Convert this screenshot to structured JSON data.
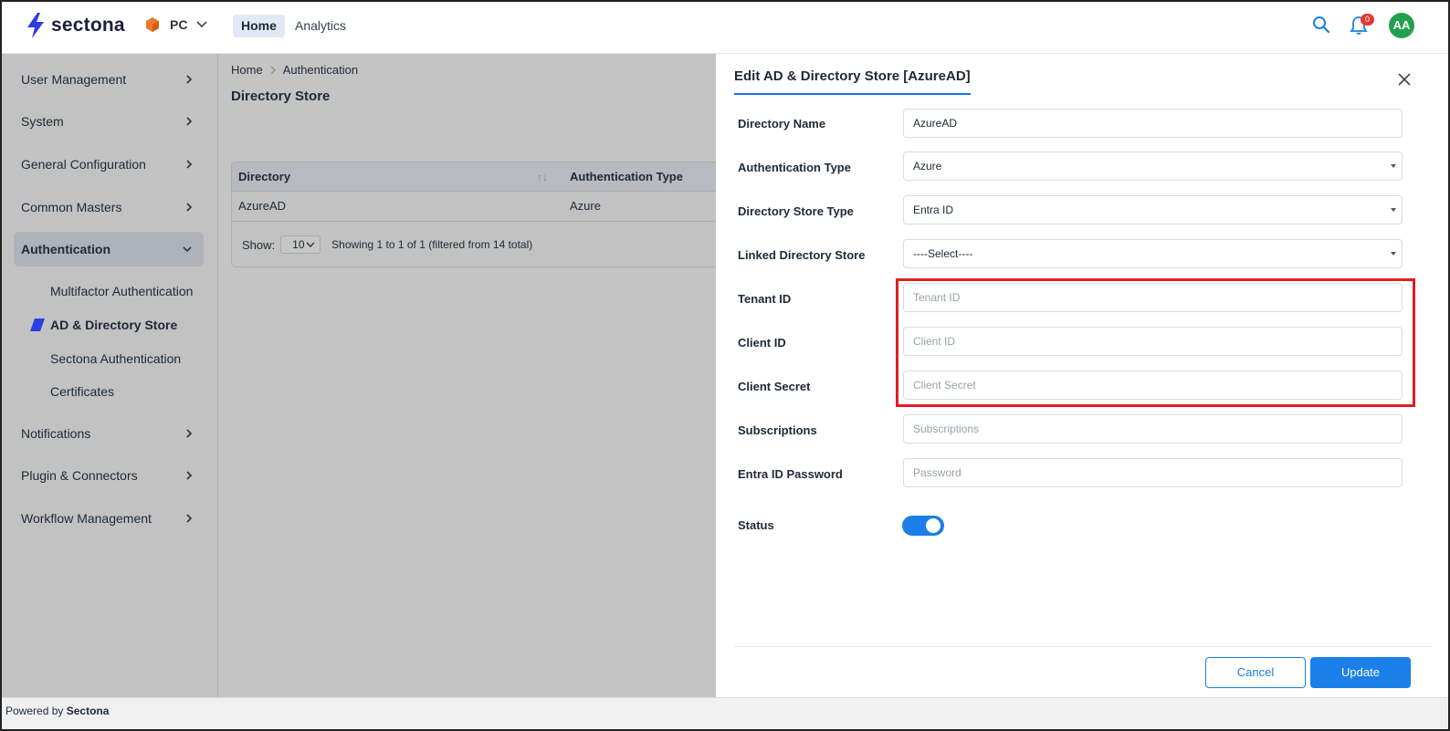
{
  "header": {
    "brand": "sectona",
    "org_label": "PC",
    "nav": {
      "home": "Home",
      "analytics": "Analytics"
    },
    "notification_count": "0",
    "avatar_initials": "AA",
    "colors": {
      "accent": "#1a7fe8",
      "avatar": "#22a04b",
      "badge": "#e53935",
      "org_icon": "#f07a2a"
    }
  },
  "sidebar": {
    "items": [
      {
        "label": "User Management"
      },
      {
        "label": "System"
      },
      {
        "label": "General Configuration"
      },
      {
        "label": "Common Masters"
      },
      {
        "label": "Authentication"
      },
      {
        "label": "Notifications"
      },
      {
        "label": "Plugin & Connectors"
      },
      {
        "label": "Workflow Management"
      }
    ],
    "sub_items": [
      {
        "label": "Multifactor Authentication"
      },
      {
        "label": "AD & Directory Store"
      },
      {
        "label": "Sectona Authentication"
      },
      {
        "label": "Certificates"
      }
    ]
  },
  "main": {
    "breadcrumb": {
      "home": "Home",
      "current": "Authentication"
    },
    "title": "Directory Store",
    "table": {
      "columns": [
        "Directory",
        "Authentication Type"
      ],
      "rows": [
        [
          "AzureAD",
          "Azure"
        ]
      ],
      "show_label": "Show:",
      "page_size": "10",
      "info": "Showing 1 to 1 of 1 (filtered from 14 total)"
    }
  },
  "drawer": {
    "title": "Edit AD & Directory Store [AzureAD]",
    "fields": {
      "directory_name": {
        "label": "Directory Name",
        "value": "AzureAD"
      },
      "auth_type": {
        "label": "Authentication Type",
        "value": "Azure"
      },
      "store_type": {
        "label": "Directory Store Type",
        "value": "Entra ID"
      },
      "linked_store": {
        "label": "Linked Directory Store",
        "value": "----Select----"
      },
      "tenant_id": {
        "label": "Tenant ID",
        "placeholder": "Tenant ID"
      },
      "client_id": {
        "label": "Client ID",
        "placeholder": "Client ID"
      },
      "client_secret": {
        "label": "Client Secret",
        "placeholder": "Client Secret"
      },
      "subscriptions": {
        "label": "Subscriptions",
        "placeholder": "Subscriptions"
      },
      "entra_password": {
        "label": "Entra ID Password",
        "placeholder": "Password"
      },
      "status": {
        "label": "Status",
        "enabled": true
      }
    },
    "buttons": {
      "cancel": "Cancel",
      "update": "Update"
    }
  },
  "footer": {
    "prefix": "Powered by",
    "brand": "Sectona"
  }
}
